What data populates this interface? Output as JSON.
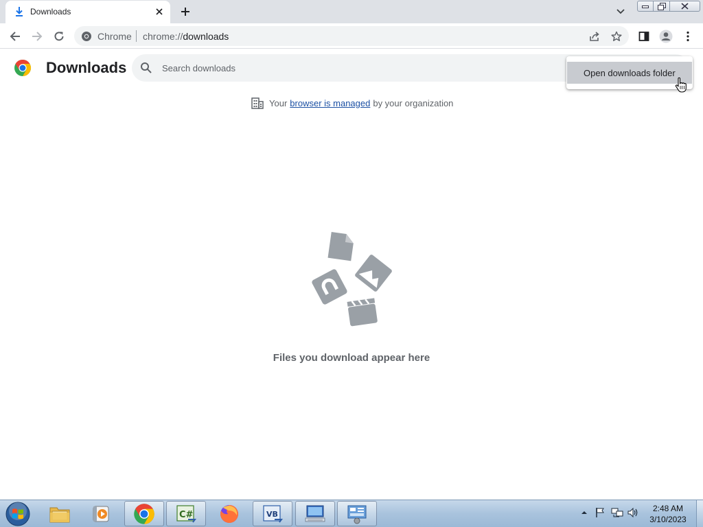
{
  "browser": {
    "tab": {
      "title": "Downloads",
      "icon": "download-icon",
      "close_icon": "close-icon"
    },
    "new_tab_icon": "plus-icon",
    "tab_search_icon": "chevron-down-icon",
    "window_controls": [
      "minimize-icon",
      "restore-icon",
      "close-icon"
    ],
    "toolbar": {
      "back_icon": "arrow-left-icon",
      "forward_icon": "arrow-right-icon",
      "reload_icon": "reload-icon",
      "site_chip": "Chrome",
      "url_scheme": "chrome://",
      "url_path": "downloads",
      "share_icon": "share-icon",
      "bookmark_icon": "star-icon",
      "side_panel_icon": "side-panel-icon",
      "profile_icon": "profile-icon",
      "menu_icon": "kebab-menu-icon"
    }
  },
  "page": {
    "title": "Downloads",
    "search": {
      "placeholder": "Search downloads",
      "value": ""
    },
    "managed": {
      "prefix": "Your",
      "link": "browser is managed",
      "suffix": "by your organization",
      "icon": "building-icon"
    },
    "empty_message": "Files you download appear here",
    "illustration_icons": [
      "document-icon",
      "image-icon",
      "audio-icon",
      "video-icon"
    ]
  },
  "menu": {
    "items": [
      {
        "label": "Open downloads folder"
      }
    ]
  },
  "taskbar": {
    "start_icon": "windows-start-icon",
    "items": [
      "file-explorer-icon",
      "media-player-icon",
      "chrome-icon",
      "csharp-icon",
      "firefox-icon",
      "vb-icon",
      "computer-icon",
      "control-panel-icon"
    ],
    "tray_icons": [
      "show-hidden-icons-icon",
      "action-center-flag-icon",
      "network-icon",
      "volume-icon"
    ],
    "time": "2:48 AM",
    "date": "3/10/2023"
  },
  "colors": {
    "tabstrip": "#dee1e6",
    "omnibox": "#f1f3f4",
    "link": "#1a4fa3",
    "menu_highlight": "#c8cbd0",
    "illustration": "#9aa0a6",
    "taskbar": "#a9c3dd"
  }
}
